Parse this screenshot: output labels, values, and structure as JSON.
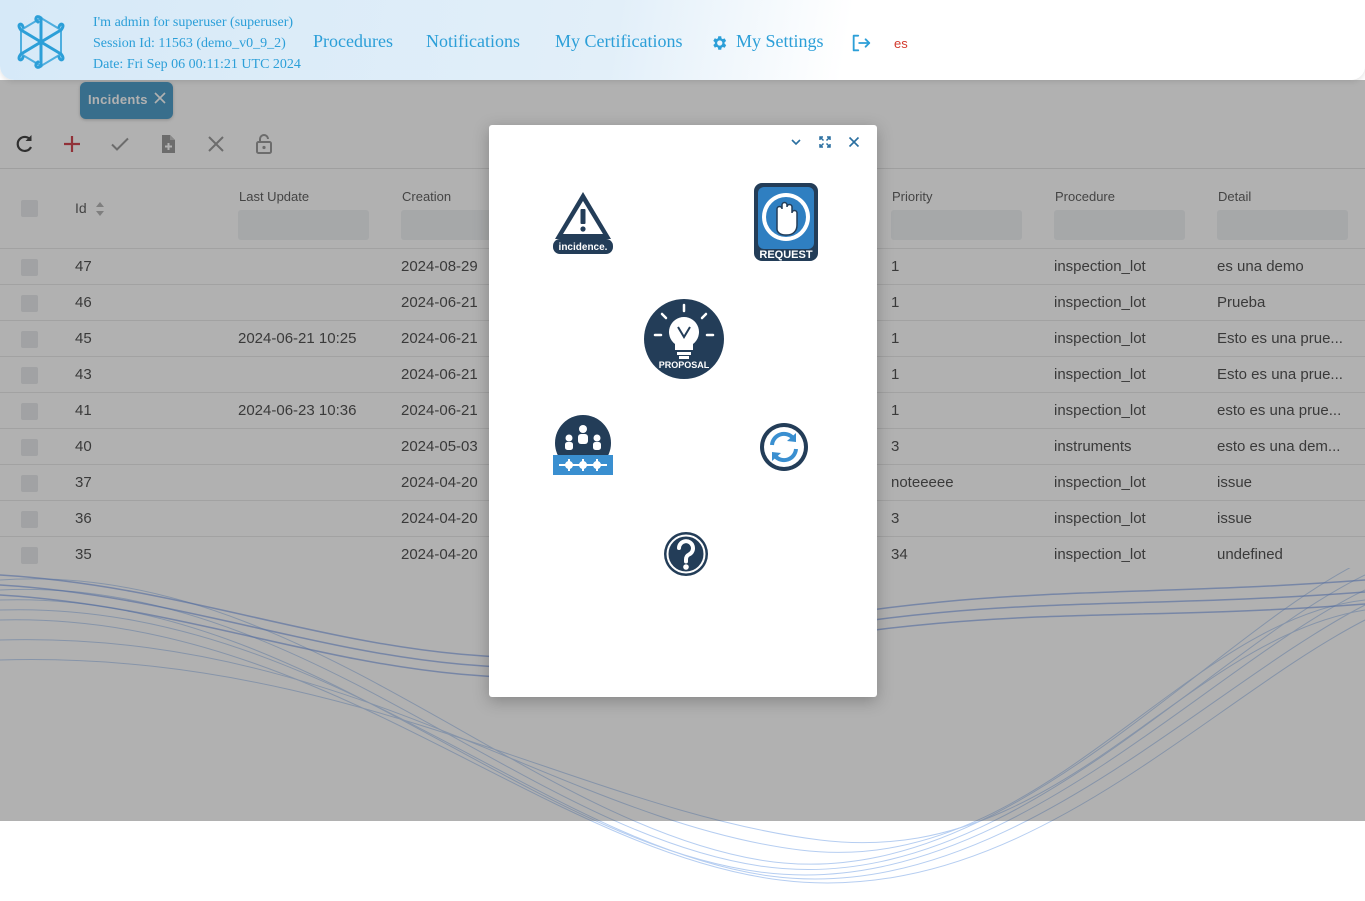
{
  "header": {
    "user_line": "I'm admin for superuser (superuser)",
    "session_line": "Session Id: 11563 (demo_v0_9_2)",
    "date_line": "Date: Fri Sep 06 00:11:21 UTC 2024",
    "nav": {
      "procedures": "Procedures",
      "notifications": "Notifications",
      "certifications": "My Certifications",
      "settings": "My Settings"
    },
    "language": "es",
    "accent_color": "#2c9fd8"
  },
  "tab": {
    "label": "Incidents"
  },
  "toolbar": [
    "refresh-icon",
    "add-icon",
    "confirm-icon",
    "new-document-icon",
    "cancel-icon",
    "unlock-icon"
  ],
  "table": {
    "columns": {
      "id": "Id",
      "last_update": "Last Update",
      "creation": "Creation",
      "priority": "Priority",
      "procedure": "Procedure",
      "detail": "Detail"
    },
    "rows": [
      {
        "id": "47",
        "last_update": "",
        "creation": "2024-08-29",
        "priority": "1",
        "procedure": "inspection_lot",
        "detail": "es una demo"
      },
      {
        "id": "46",
        "last_update": "",
        "creation": "2024-06-21",
        "priority": "1",
        "procedure": "inspection_lot",
        "detail": "Prueba"
      },
      {
        "id": "45",
        "last_update": "2024-06-21 10:25",
        "creation": "2024-06-21",
        "priority": "1",
        "procedure": "inspection_lot",
        "detail": "Esto es una prue..."
      },
      {
        "id": "43",
        "last_update": "",
        "creation": "2024-06-21",
        "priority": "1",
        "procedure": "inspection_lot",
        "detail": "Esto es una prue..."
      },
      {
        "id": "41",
        "last_update": "2024-06-23 10:36",
        "creation": "2024-06-21",
        "priority": "1",
        "procedure": "inspection_lot",
        "detail": "esto es una prue..."
      },
      {
        "id": "40",
        "last_update": "",
        "creation": "2024-05-03",
        "priority": "3",
        "procedure": "instruments",
        "detail": "esto es una dem..."
      },
      {
        "id": "37",
        "last_update": "",
        "creation": "2024-04-20",
        "priority": "noteeeee",
        "procedure": "inspection_lot",
        "detail": "issue"
      },
      {
        "id": "36",
        "last_update": "",
        "creation": "2024-04-20",
        "priority": "3",
        "procedure": "inspection_lot",
        "detail": "issue"
      },
      {
        "id": "35",
        "last_update": "",
        "creation": "2024-04-20",
        "priority": "34",
        "procedure": "inspection_lot",
        "detail": "undefined"
      }
    ]
  },
  "modal": {
    "controls": [
      "collapse-icon",
      "expand-icon",
      "close-icon"
    ],
    "options": {
      "incidence": "incidence.",
      "request": "REQUEST",
      "proposal": "PROPOSAL"
    },
    "icon_color": "#233d58"
  }
}
